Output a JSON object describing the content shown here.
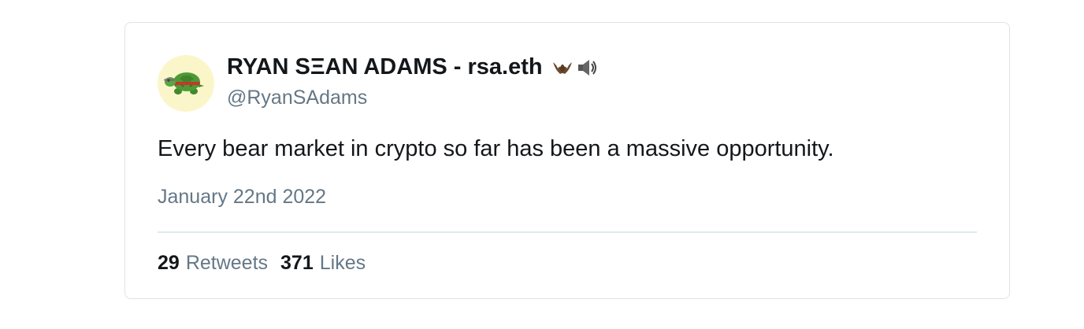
{
  "tweet": {
    "display_name": "RYAN SΞAN ADAMS - rsa.eth",
    "name_emojis": [
      "bat-icon",
      "speaker-icon"
    ],
    "handle": "@RyanSAdams",
    "text": "Every bear market in crypto so far has been a massive opportunity.",
    "date": "January 22nd 2022",
    "retweets_count": "29",
    "retweets_label": "Retweets",
    "likes_count": "371",
    "likes_label": "Likes"
  },
  "colors": {
    "text_primary": "#14171a",
    "text_secondary": "#657786",
    "border": "#dfe3e7",
    "avatar_background": "#fbf6c9"
  }
}
